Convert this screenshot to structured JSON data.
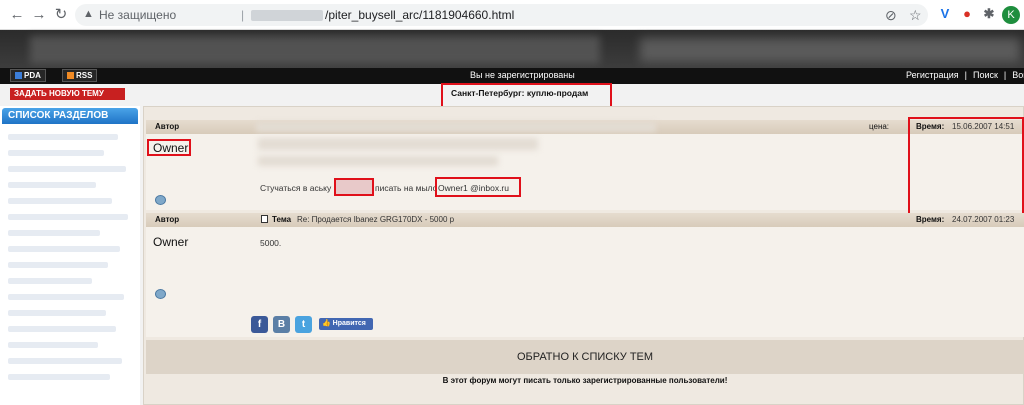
{
  "browser": {
    "insecure_label": "Не защищено",
    "separator": "|",
    "url_path": "/piter_buysell_arc/1181904660.html",
    "avatar_letter": "K",
    "accent": "#1e8e3e"
  },
  "topbar": {
    "pda": "PDA",
    "rss": "RSS",
    "status": "Вы не зарегистрированы",
    "links": [
      "Регистрация",
      "|",
      "Поиск",
      "|",
      "Войти"
    ]
  },
  "new_topic_button": "ЗАДАТЬ НОВУЮ ТЕМУ",
  "forum_title": "Санкт-Петербург: куплю-продам",
  "sidebar": {
    "title": "СПИСОК РАЗДЕЛОВ"
  },
  "posts": [
    {
      "author_label": "Автор",
      "price_label": "цена:",
      "time_label": "Время:",
      "time": "15.06.2007 14:51",
      "author": "Owner",
      "contact_prefix": "Стучаться в аську",
      "contact_middle": "писать на мыло",
      "email": "Owner1 @inbox.ru"
    },
    {
      "author_label": "Автор",
      "topic_label": "Тема",
      "topic": "Re: Продается Ibanez GRG170DX - 5000 р",
      "time_label": "Время:",
      "time": "24.07.2007 01:23",
      "author": "Owner",
      "body": "5000."
    }
  ],
  "social": {
    "facebook": "f",
    "vk": "B",
    "twitter": "t",
    "like": "Нравится"
  },
  "back_link": "ОБРАТНО К СПИСКУ ТЕМ",
  "footer_note": "В этот форум могут писать только зарегистрированные пользователи!",
  "colors": {
    "highlight_box": "#e0101a",
    "new_topic_bg": "#c82020",
    "sidebar_head": "#1f73c6"
  }
}
